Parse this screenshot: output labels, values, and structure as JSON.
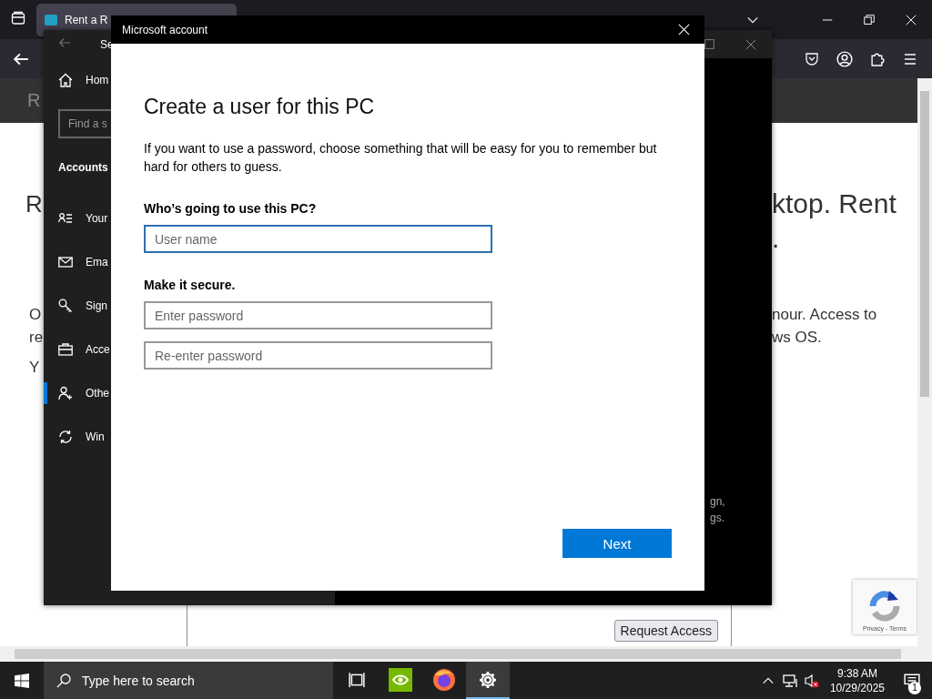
{
  "browser": {
    "tab": {
      "title": "Rent a R"
    },
    "page": {
      "header_text": "R",
      "heading_left": "R",
      "heading_right": [
        "ktop. Rent",
        "."
      ],
      "paragraph_left": [
        "O",
        "re"
      ],
      "paragraph_right": [
        "nour. Access to",
        "ws OS."
      ],
      "line_left": "Y",
      "request_button": "Request Access",
      "recaptcha": "Privacy - Terms"
    }
  },
  "settings_window": {
    "title": "Se",
    "home": "Hom",
    "search": {
      "placeholder": "Find a s"
    },
    "section": "Accounts",
    "items": [
      {
        "label": "Your",
        "selected": false
      },
      {
        "label": "Ema",
        "selected": false
      },
      {
        "label": "Sign",
        "selected": false
      },
      {
        "label": "Acce",
        "selected": false
      },
      {
        "label": "Othe",
        "selected": true
      },
      {
        "label": "Win",
        "selected": false
      }
    ],
    "content_fragments": [
      "gn,",
      "gs."
    ]
  },
  "dialog": {
    "title": "Microsoft account",
    "heading": "Create a user for this PC",
    "intro": "If you want to use a password, choose something that will be easy for you to remember but hard for others to guess.",
    "sections": [
      {
        "label": "Who’s going to use this PC?",
        "fields": [
          {
            "placeholder": "User name",
            "focused": true
          }
        ]
      },
      {
        "label": "Make it secure.",
        "fields": [
          {
            "placeholder": "Enter password",
            "focused": false
          },
          {
            "placeholder": "Re-enter password",
            "focused": false
          }
        ]
      }
    ],
    "next_button": "Next"
  },
  "taskbar": {
    "search_placeholder": "Type here to search",
    "apps": [
      {
        "kind": "taskview",
        "active": false
      },
      {
        "kind": "nvidia",
        "active": false
      },
      {
        "kind": "firefox",
        "active": false
      },
      {
        "kind": "settings",
        "active": true
      }
    ],
    "time": "9:38 AM",
    "date": "10/29/2025",
    "notifications": "1"
  }
}
